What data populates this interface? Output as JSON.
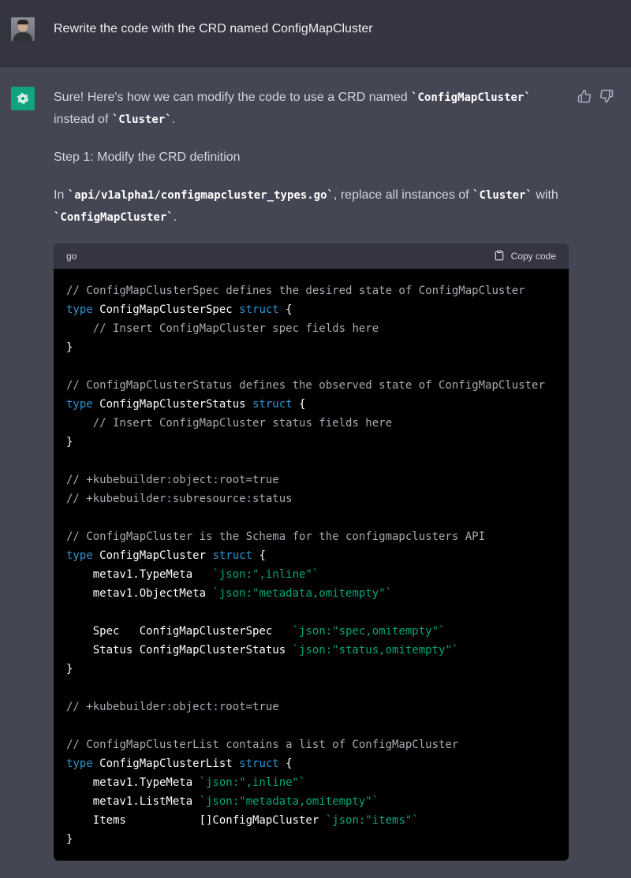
{
  "user_message": {
    "text": "Rewrite the code with the CRD named ConfigMapCluster"
  },
  "assistant_message": {
    "intro_a": "Sure! Here's how we can modify the code to use a CRD named ",
    "intro_code1": "`ConfigMapCluster`",
    "intro_b": " instead of ",
    "intro_code2": "`Cluster`",
    "intro_c": ".",
    "step1": "Step 1: Modify the CRD definition",
    "instr_a": "In ",
    "instr_code1": "`api/v1alpha1/configmapcluster_types.go`",
    "instr_b": ", replace all instances of ",
    "instr_code2": "`Cluster`",
    "instr_c": " with ",
    "instr_code3": "`ConfigMapCluster`",
    "instr_d": "."
  },
  "code_block": {
    "language": "go",
    "copy_label": "Copy code",
    "lines": [
      [
        [
          "cm",
          "// ConfigMapClusterSpec defines the desired state of ConfigMapCluster"
        ]
      ],
      [
        [
          "kw",
          "type"
        ],
        [
          "",
          " ConfigMapClusterSpec "
        ],
        [
          "kw",
          "struct"
        ],
        [
          "",
          " {"
        ]
      ],
      [
        [
          "",
          "    "
        ],
        [
          "cm",
          "// Insert ConfigMapCluster spec fields here"
        ]
      ],
      [
        [
          "",
          "}"
        ]
      ],
      [
        [
          "",
          ""
        ]
      ],
      [
        [
          "cm",
          "// ConfigMapClusterStatus defines the observed state of ConfigMapCluster"
        ]
      ],
      [
        [
          "kw",
          "type"
        ],
        [
          "",
          " ConfigMapClusterStatus "
        ],
        [
          "kw",
          "struct"
        ],
        [
          "",
          " {"
        ]
      ],
      [
        [
          "",
          "    "
        ],
        [
          "cm",
          "// Insert ConfigMapCluster status fields here"
        ]
      ],
      [
        [
          "",
          "}"
        ]
      ],
      [
        [
          "",
          ""
        ]
      ],
      [
        [
          "cm",
          "// +kubebuilder:object:root=true"
        ]
      ],
      [
        [
          "cm",
          "// +kubebuilder:subresource:status"
        ]
      ],
      [
        [
          "",
          ""
        ]
      ],
      [
        [
          "cm",
          "// ConfigMapCluster is the Schema for the configmapclusters API"
        ]
      ],
      [
        [
          "kw",
          "type"
        ],
        [
          "",
          " ConfigMapCluster "
        ],
        [
          "kw",
          "struct"
        ],
        [
          "",
          " {"
        ]
      ],
      [
        [
          "",
          "    metav1.TypeMeta   "
        ],
        [
          "st",
          "`json:\",inline\"`"
        ]
      ],
      [
        [
          "",
          "    metav1.ObjectMeta "
        ],
        [
          "st",
          "`json:\"metadata,omitempty\"`"
        ]
      ],
      [
        [
          "",
          ""
        ]
      ],
      [
        [
          "",
          "    Spec   ConfigMapClusterSpec   "
        ],
        [
          "st",
          "`json:\"spec,omitempty\"`"
        ]
      ],
      [
        [
          "",
          "    Status ConfigMapClusterStatus "
        ],
        [
          "st",
          "`json:\"status,omitempty\"`"
        ]
      ],
      [
        [
          "",
          "}"
        ]
      ],
      [
        [
          "",
          ""
        ]
      ],
      [
        [
          "cm",
          "// +kubebuilder:object:root=true"
        ]
      ],
      [
        [
          "",
          ""
        ]
      ],
      [
        [
          "cm",
          "// ConfigMapClusterList contains a list of ConfigMapCluster"
        ]
      ],
      [
        [
          "kw",
          "type"
        ],
        [
          "",
          " ConfigMapClusterList "
        ],
        [
          "kw",
          "struct"
        ],
        [
          "",
          " {"
        ]
      ],
      [
        [
          "",
          "    metav1.TypeMeta "
        ],
        [
          "st",
          "`json:\",inline\"`"
        ]
      ],
      [
        [
          "",
          "    metav1.ListMeta "
        ],
        [
          "st",
          "`json:\"metadata,omitempty\"`"
        ]
      ],
      [
        [
          "",
          "    Items           []ConfigMapCluster "
        ],
        [
          "st",
          "`json:\"items\"`"
        ]
      ],
      [
        [
          "",
          "}"
        ]
      ]
    ]
  },
  "colors": {
    "user_bg": "#343541",
    "assistant_bg": "#444654",
    "brand": "#10a37f",
    "code_bg": "#000000",
    "code_keyword": "#2e95d3",
    "code_string": "#00a67d",
    "code_comment": "#a9a9b3"
  },
  "icons": {
    "user_avatar": "user-photo-avatar",
    "assistant_avatar": "openai-logo-icon",
    "like": "thumbs-up-icon",
    "dislike": "thumbs-down-icon",
    "copy": "clipboard-icon"
  }
}
